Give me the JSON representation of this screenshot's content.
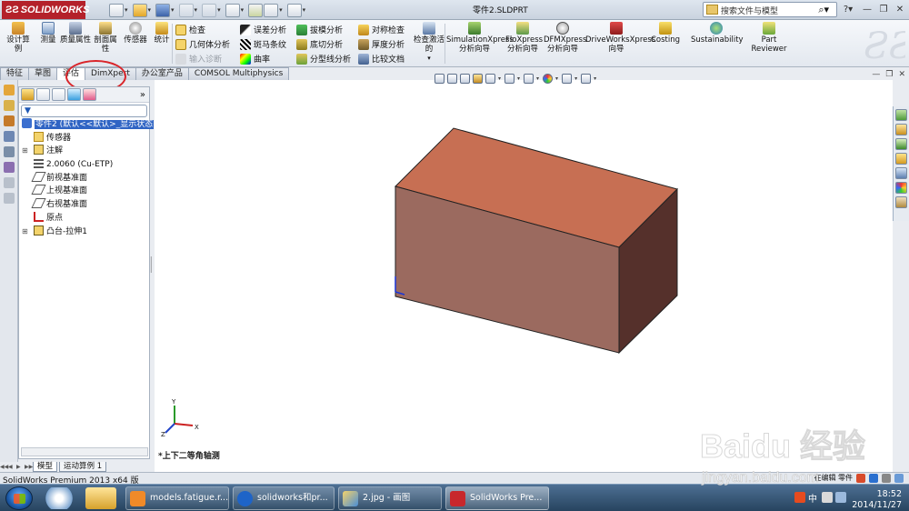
{
  "app": {
    "logo": "SOLIDWORKS",
    "document_title": "零件2.SLDPRT",
    "search_placeholder": "搜索文件与模型",
    "help_icon": "help-icon"
  },
  "command_manager": {
    "big_buttons": [
      {
        "label": "设计算例",
        "icon": "design-study-icon"
      },
      {
        "label": "测量",
        "icon": "measure-icon"
      },
      {
        "label": "质量属性",
        "icon": "mass-properties-icon"
      },
      {
        "label": "剖面属性",
        "icon": "section-properties-icon"
      },
      {
        "label": "传感器",
        "icon": "sensor-icon"
      },
      {
        "label": "统计",
        "icon": "statistics-icon"
      }
    ],
    "check_group": [
      {
        "label": "检查",
        "enabled": true
      },
      {
        "label": "几何体分析",
        "enabled": true
      },
      {
        "label": "输入诊断",
        "enabled": false
      }
    ],
    "analysis_group_1": [
      {
        "label": "误差分析"
      },
      {
        "label": "斑马条纹"
      },
      {
        "label": "曲率"
      }
    ],
    "analysis_group_2": [
      {
        "label": "拔模分析"
      },
      {
        "label": "底切分析"
      },
      {
        "label": "分型线分析"
      }
    ],
    "analysis_group_3": [
      {
        "label": "对称检查"
      },
      {
        "label": "厚度分析"
      },
      {
        "label": "比较文档"
      }
    ],
    "check_active": "检查激活的",
    "xpress_buttons": [
      {
        "label": "SimulationXpress 分析向导"
      },
      {
        "label": "FloXpress 分析向导"
      },
      {
        "label": "DFMXpress 分析向导"
      },
      {
        "label": "DriveWorksXpress 向导"
      },
      {
        "label": "Costing"
      },
      {
        "label": "Sustainability"
      },
      {
        "label": "Part Reviewer"
      }
    ]
  },
  "tabs": [
    {
      "label": "特征",
      "active": false
    },
    {
      "label": "草图",
      "active": false
    },
    {
      "label": "评估",
      "active": true
    },
    {
      "label": "DimXpert",
      "active": false
    },
    {
      "label": "办公室产品",
      "active": false
    },
    {
      "label": "COMSOL Multiphysics",
      "active": false
    }
  ],
  "feature_tree": {
    "root": "零件2 (默认<<默认>_显示状态",
    "items": [
      {
        "label": "传感器",
        "icon": "sensor-folder-icon",
        "expandable": false
      },
      {
        "label": "注解",
        "icon": "annotation-icon",
        "expandable": true
      },
      {
        "label": "2.0060 (Cu-ETP)",
        "icon": "material-icon",
        "expandable": false
      },
      {
        "label": "前视基准面",
        "icon": "plane-icon",
        "expandable": false
      },
      {
        "label": "上视基准面",
        "icon": "plane-icon",
        "expandable": false
      },
      {
        "label": "右视基准面",
        "icon": "plane-icon",
        "expandable": false
      },
      {
        "label": "原点",
        "icon": "origin-icon",
        "expandable": false
      },
      {
        "label": "凸台-拉伸1",
        "icon": "extrude-icon",
        "expandable": true
      }
    ]
  },
  "bottom_tabs": [
    {
      "label": "模型",
      "active": true
    },
    {
      "label": "运动算例 1",
      "active": false
    }
  ],
  "graphics": {
    "view_label": "*上下二等角轴测",
    "triad": {
      "x": "X",
      "y": "Y",
      "z": "Z"
    },
    "box_colors": {
      "top": "#c76f53",
      "front": "#9b6a5f",
      "side": "#55302b"
    }
  },
  "status": {
    "text": "SolidWorks Premium 2013 x64 版",
    "right_text": "在编辑 零件"
  },
  "taskbar": {
    "items": [
      {
        "label": "models.fatigue.r...",
        "icon": "pdf-icon",
        "active": false
      },
      {
        "label": "solidworks和pr...",
        "icon": "sogou-icon",
        "active": false
      },
      {
        "label": "2.jpg - 画图",
        "icon": "paint-icon",
        "active": false
      },
      {
        "label": "SolidWorks Pre...",
        "icon": "solidworks-icon",
        "active": true
      }
    ],
    "ime": "中",
    "clock_time": "18:52",
    "clock_date": "2014/11/27"
  },
  "watermark": {
    "brand": "Baidu 经验",
    "url": "jingyan.baidu.com"
  }
}
